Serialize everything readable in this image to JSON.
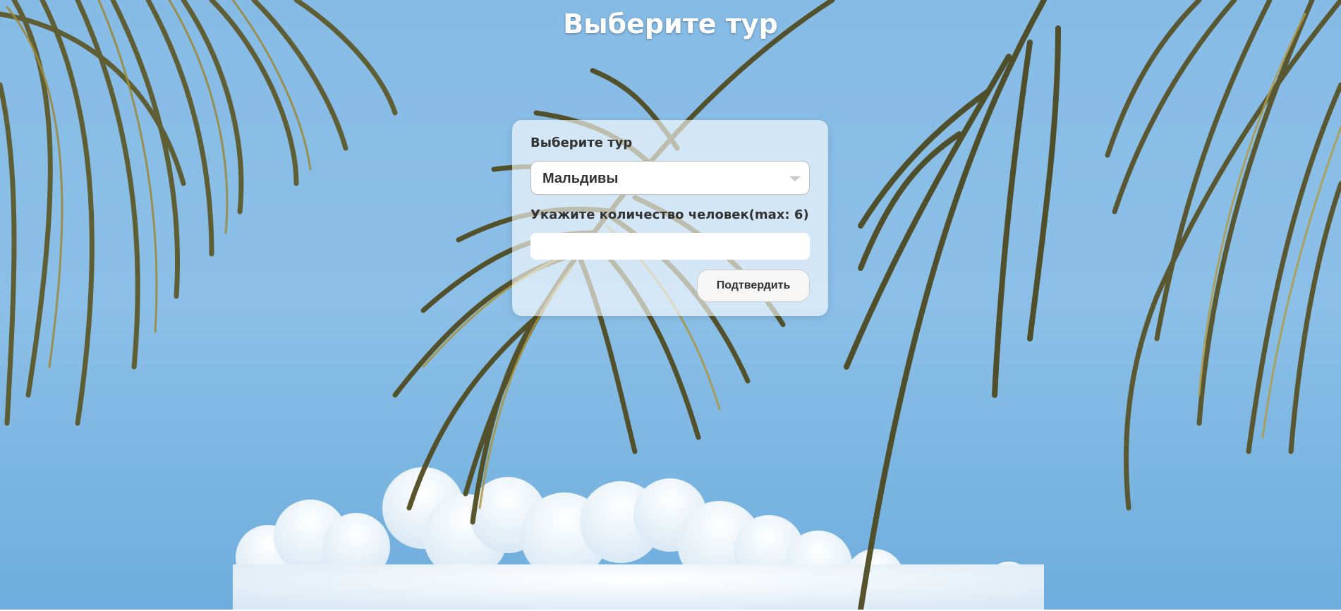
{
  "page": {
    "title": "Выберите тур",
    "background": "tropical-palm-sky-photo"
  },
  "form": {
    "tour_label": "Выберите тур",
    "tour_select": {
      "selected": "Мальдивы"
    },
    "people_label": "Укажите количество человек(max: 6)",
    "people_input": {
      "value": "",
      "placeholder": ""
    },
    "confirm_label": "Подтвердить"
  },
  "colors": {
    "sky": "#7fb3e2",
    "card": "#ffffff",
    "title_text": "#ffffff",
    "label_text": "#333333"
  }
}
